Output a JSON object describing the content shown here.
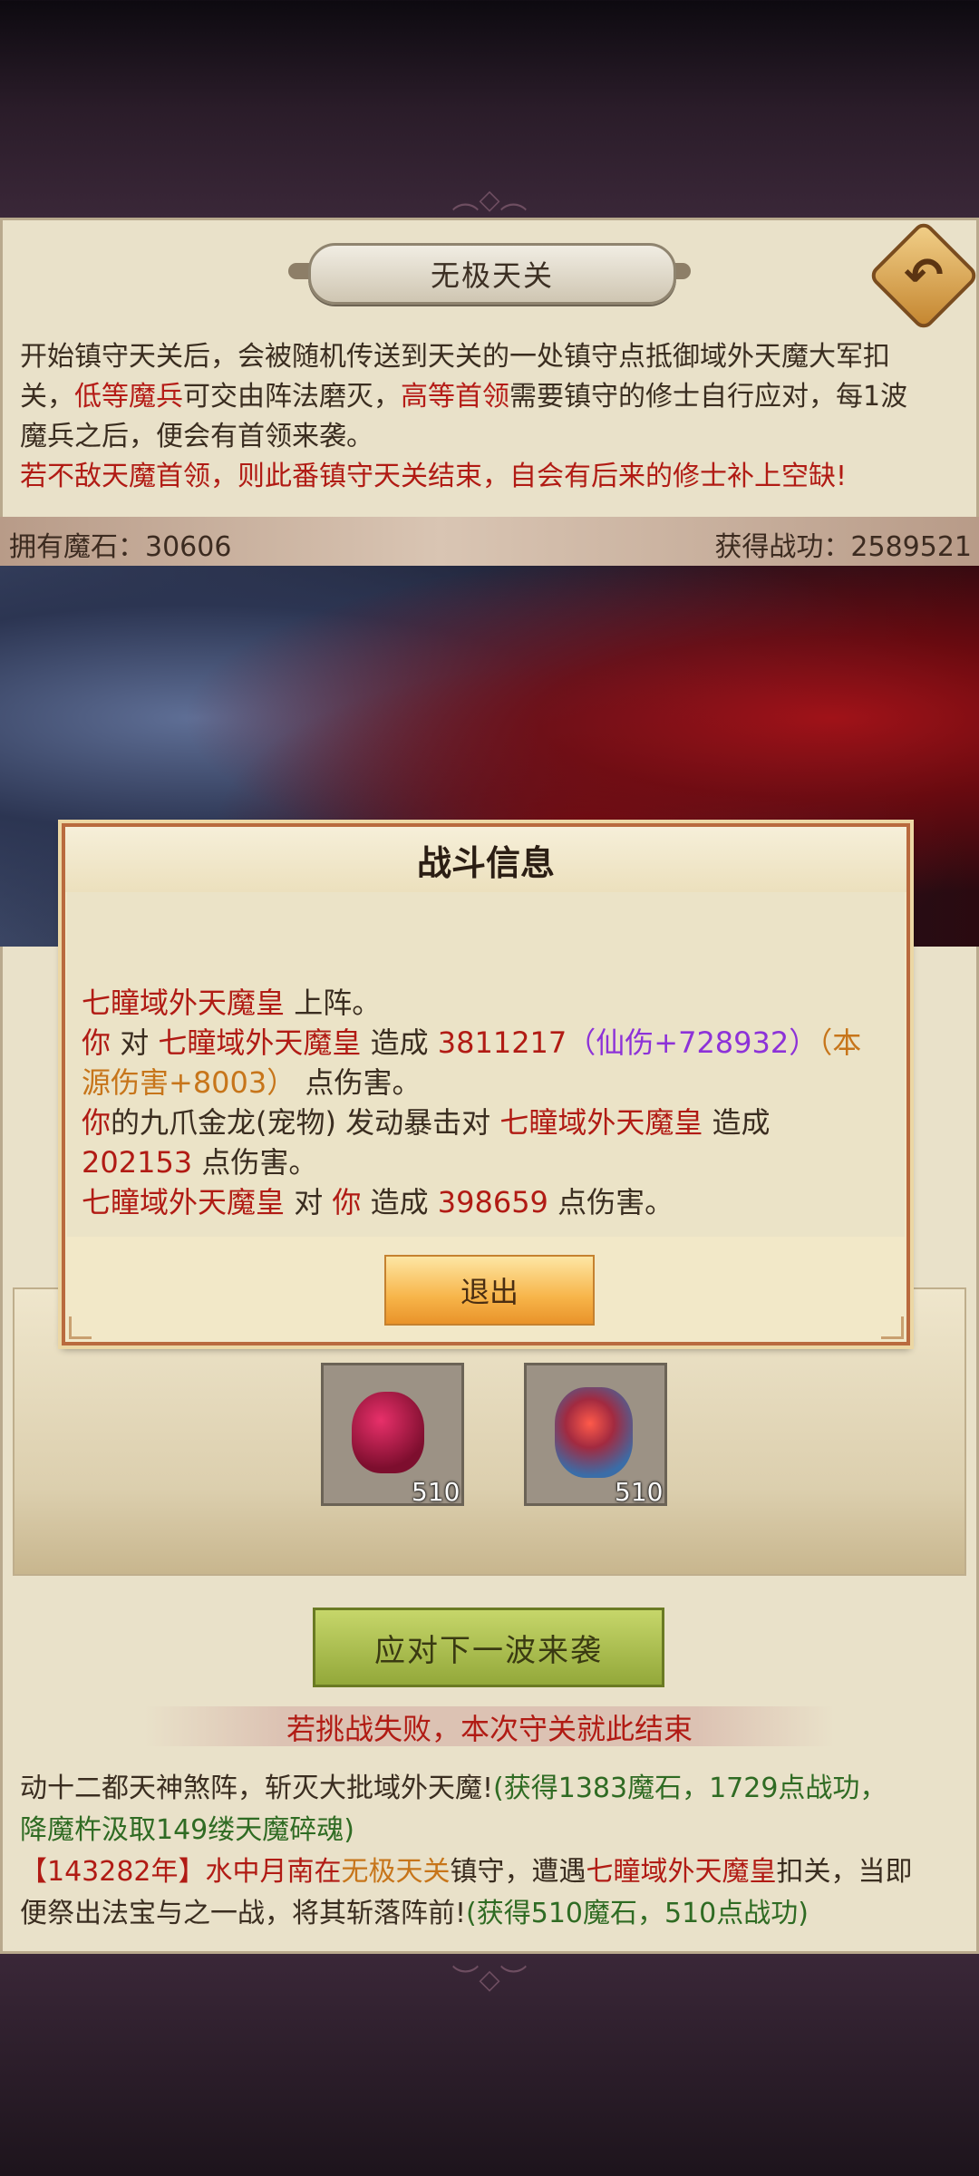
{
  "header": {
    "title": "无极天关"
  },
  "description": {
    "line1": "开始镇守天关后，会被随机传送到天关的一处镇守点抵御域外天魔大军扣",
    "line2_a": "关，",
    "line2_low": "低等魔兵",
    "line2_b": "可交由阵法磨灭，",
    "line2_high": "高等首领",
    "line2_c": "需要镇守的修士自行应对，每1波",
    "line3": "魔兵之后，便会有首领来袭。",
    "warning": "若不敌天魔首领，则此番镇守天关结束，自会有后来的修士补上空缺!"
  },
  "stats": {
    "demon_stones": "拥有魔石：30606",
    "merit": "获得战功：2589521"
  },
  "rewards": [
    {
      "icon": "red-demon-stone-icon",
      "count": "510"
    },
    {
      "icon": "blue-red-token-icon",
      "count": "510"
    }
  ],
  "actions": {
    "next_wave": "应对下一波来袭",
    "fail_notice": "若挑战失败，本次守关就此结束"
  },
  "log": {
    "l1_a": "动十二都天神煞阵，斩灭大批域外天魔!",
    "l1_b": "(获得1383魔石，1729点战功，",
    "l2": "降魔杵汲取149缕天魔碎魂)",
    "l3_a": "【143282年】水中月南在",
    "l3_loc": "无极天关",
    "l3_b": "镇守，遭遇",
    "l3_boss": "七瞳域外天魔皇",
    "l3_c": "扣关，当即",
    "l4_a": "便祭出法宝与之一战，将其斩落阵前!",
    "l4_b": "(获得510魔石，510点战功)"
  },
  "dialog": {
    "title": "战斗信息",
    "m1_name": "七瞳域外天魔皇",
    "m1_rest": " 上阵。",
    "m2_you": "你",
    "m2_a": " 对 ",
    "m2_name": "七瞳域外天魔皇",
    "m2_b": " 造成 ",
    "m2_dmg": "3811217",
    "m2_xian": "（仙伤+728932）",
    "m2_src": "（本源伤害+8003）",
    "m2_c": " 点伤害。",
    "m3_you": "你",
    "m3_a": "的九爪金龙(宠物) 发动暴击对 ",
    "m3_name": "七瞳域外天魔皇",
    "m3_b": " 造成 ",
    "m3_dmg": "202153",
    "m3_c": " 点伤害。",
    "m4_name": "七瞳域外天魔皇",
    "m4_a": " 对 ",
    "m4_you": "你",
    "m4_b": " 造成 ",
    "m4_dmg": "398659",
    "m4_c": " 点伤害。",
    "exit": "退出"
  }
}
